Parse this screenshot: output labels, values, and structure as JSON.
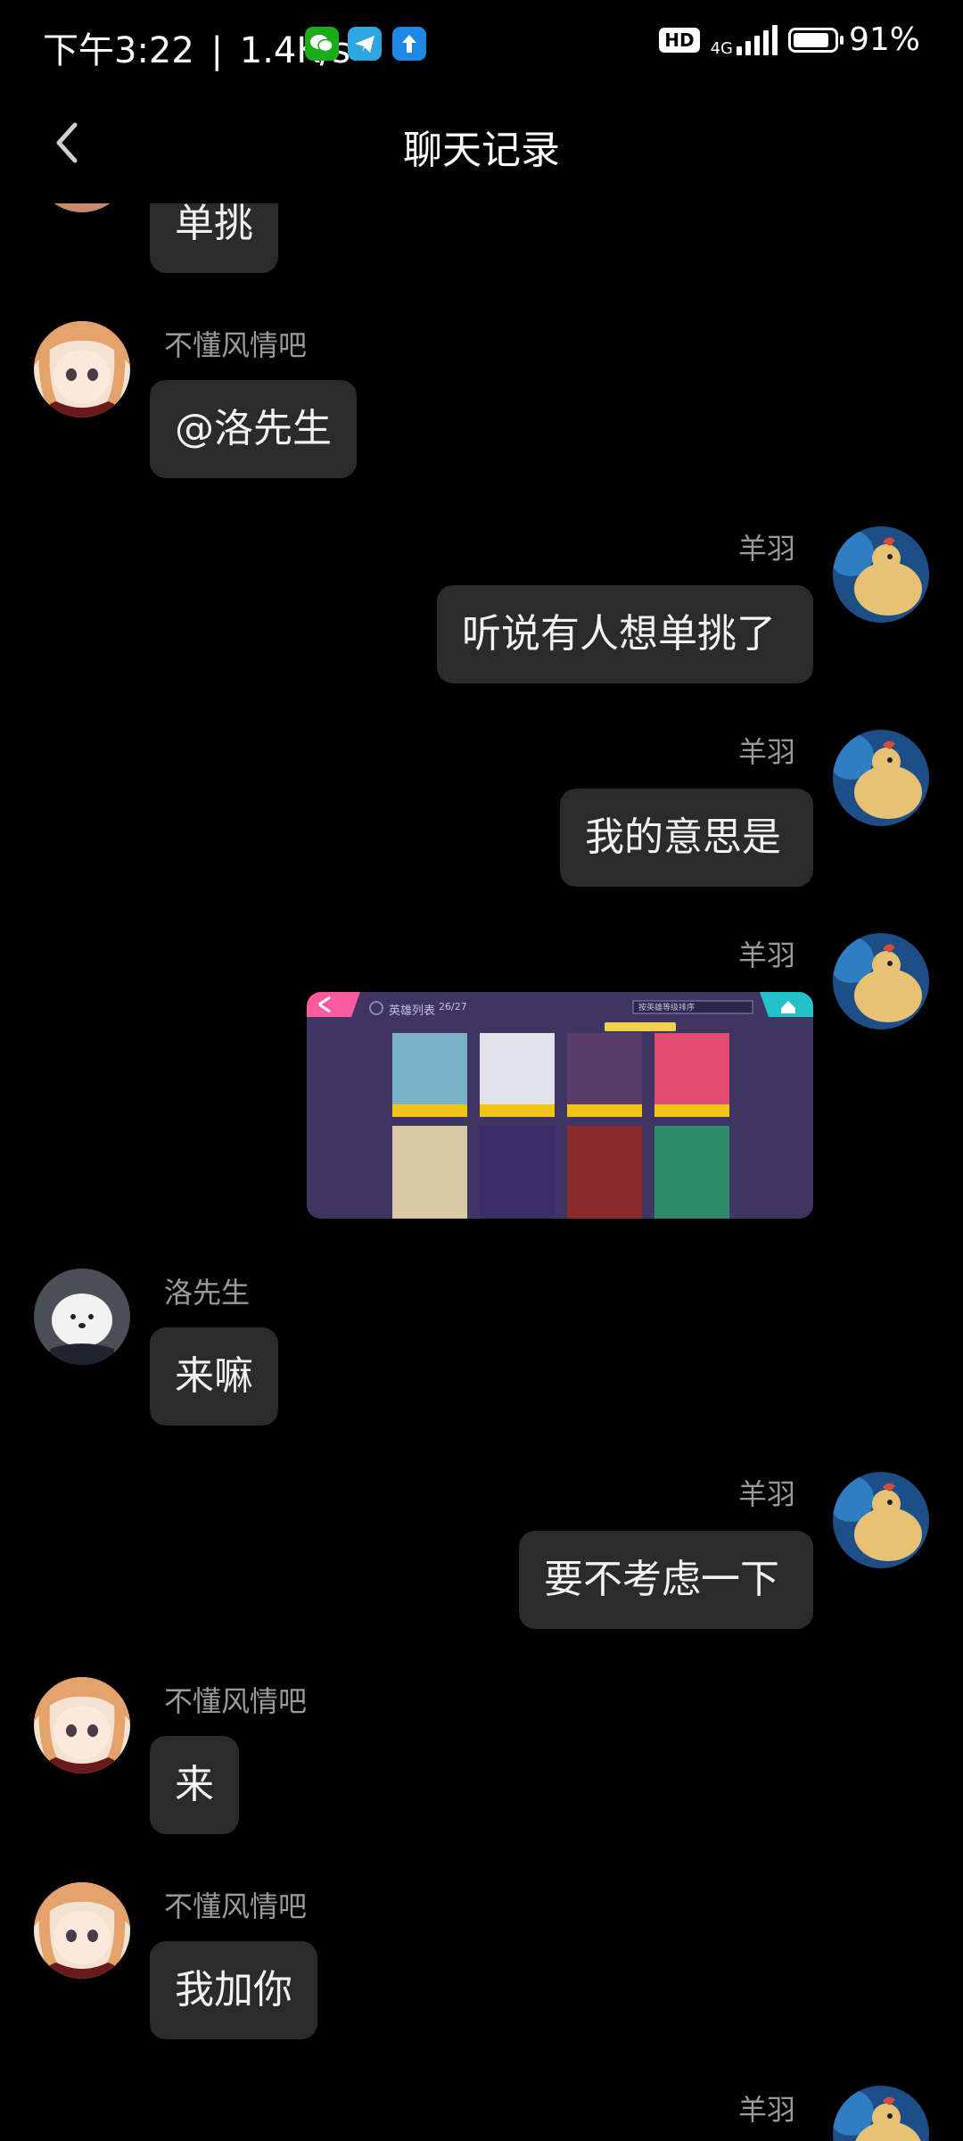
{
  "status_bar": {
    "time": "下午3:22",
    "speed": "1.4K/s",
    "hd": "HD",
    "network": "4G",
    "battery": "91",
    "battery_pct": "91%",
    "battery_level": 0.91,
    "apps": [
      "wechat-icon",
      "telegram-icon",
      "upload-icon"
    ]
  },
  "header": {
    "title": "聊天记录"
  },
  "messages": [
    {
      "side": "left",
      "text": "单挑"
    },
    {
      "side": "left",
      "sender": "不懂风情吧",
      "text": "@洛先生"
    },
    {
      "side": "right",
      "sender": "羊羽",
      "text": "听说有人想单挑了"
    },
    {
      "side": "right",
      "sender": "羊羽",
      "text": "我的意思是"
    },
    {
      "side": "right",
      "sender": "羊羽",
      "image": {
        "title": "英雄列表",
        "count": "26/27",
        "dropdown": "按英雄等级排序"
      }
    },
    {
      "side": "left",
      "sender": "洛先生",
      "text": "来嘛"
    },
    {
      "side": "right",
      "sender": "羊羽",
      "text": "要不考虑一下"
    },
    {
      "side": "left",
      "sender": "不懂风情吧",
      "text": "来"
    },
    {
      "side": "left",
      "sender": "不懂风情吧",
      "text": "我加你"
    },
    {
      "side": "right",
      "sender": "羊羽"
    }
  ],
  "colors": {
    "background": "#000000",
    "bubble": "#2b2b2b",
    "sender_name": "#9a9a9a",
    "image_card_bg": "#4b3f73"
  }
}
